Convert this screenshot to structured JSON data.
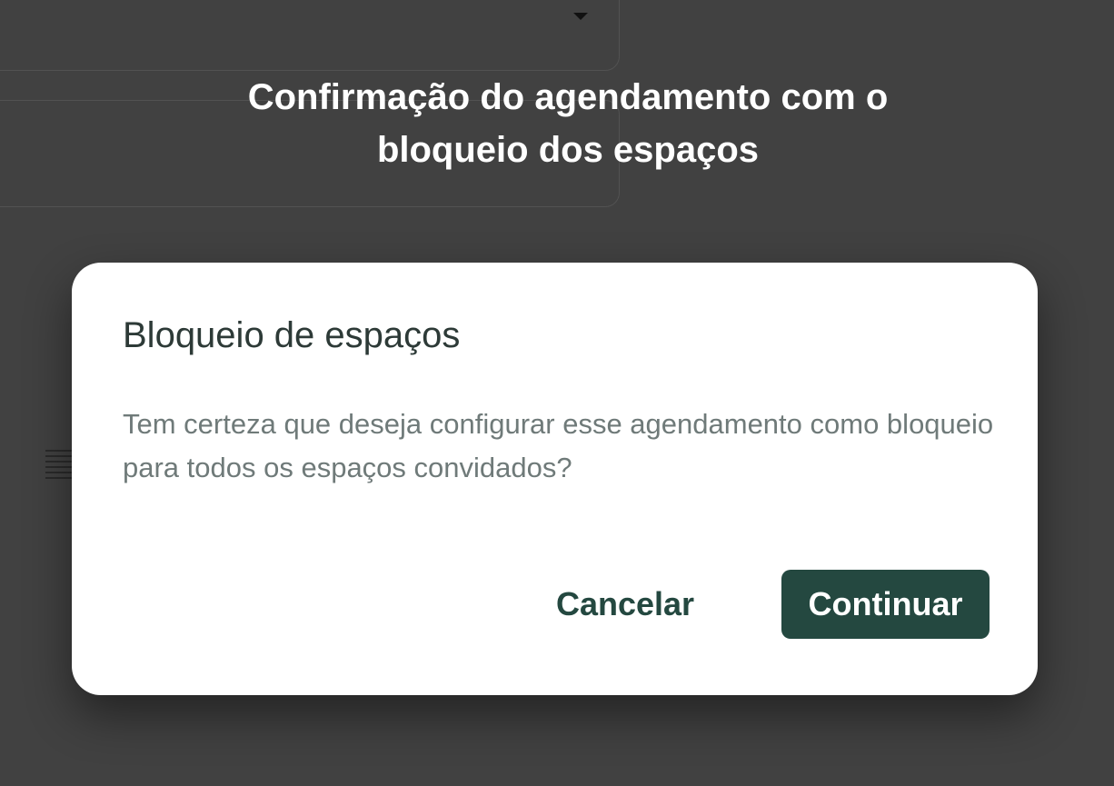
{
  "background": {
    "title": "Confirmação do agendamento com o bloqueio dos espaços"
  },
  "dialog": {
    "title": "Bloqueio de espaços",
    "message": "Tem certeza que deseja configurar esse agendamento como bloqueio para todos os espaços convidados?",
    "cancel_label": "Cancelar",
    "continue_label": "Continuar"
  },
  "colors": {
    "overlay": "#414141",
    "primary": "#244840",
    "title_text": "#2d3a37",
    "body_text": "#6f7a79"
  }
}
